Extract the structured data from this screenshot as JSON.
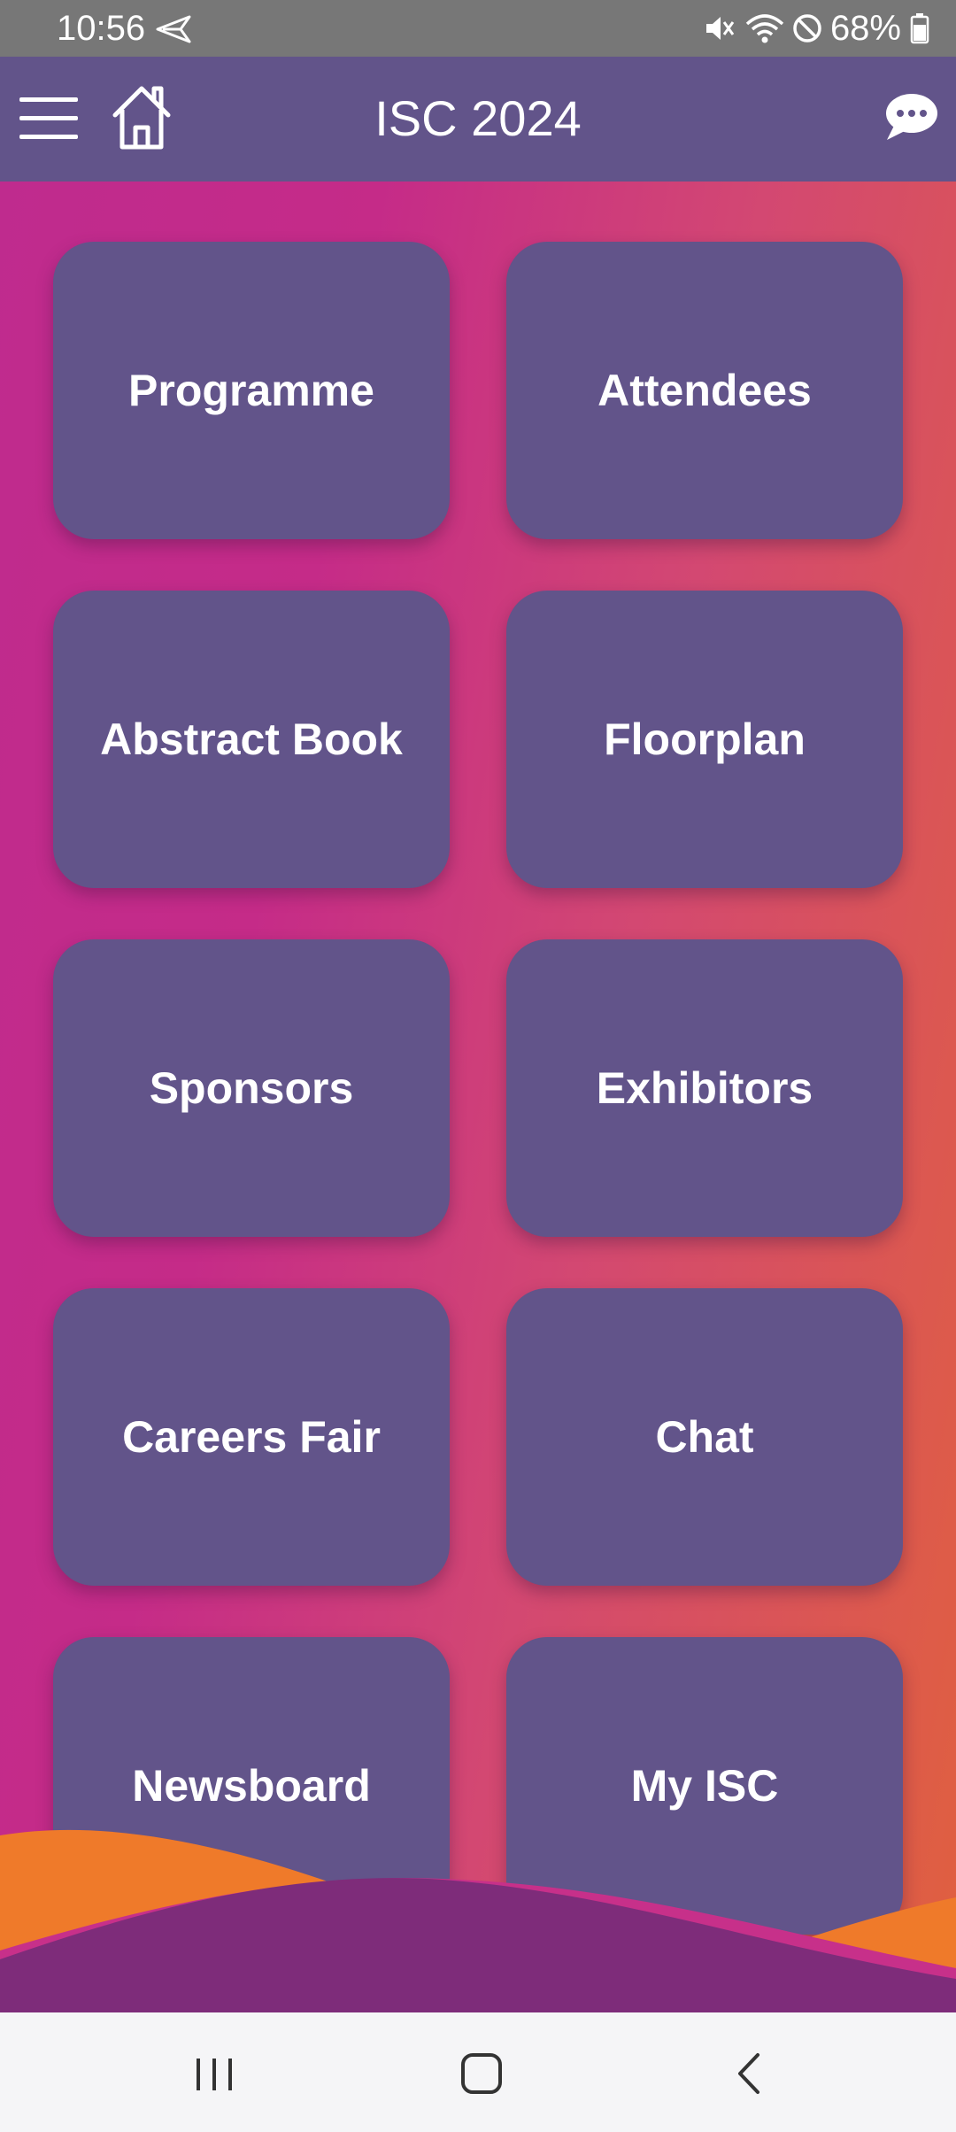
{
  "status_bar": {
    "time": "10:56",
    "battery": "68%",
    "icons": [
      "send-icon",
      "mute-icon",
      "wifi-icon",
      "do-not-disturb-icon",
      "battery-icon"
    ]
  },
  "app_bar": {
    "title": "ISC 2024",
    "menu_icon": "hamburger-menu-icon",
    "home_icon": "home-icon",
    "chat_icon": "chat-bubble-icon"
  },
  "tiles": [
    {
      "label": "Programme"
    },
    {
      "label": "Attendees"
    },
    {
      "label": "Abstract Book"
    },
    {
      "label": "Floorplan"
    },
    {
      "label": "Sponsors"
    },
    {
      "label": "Exhibitors"
    },
    {
      "label": "Careers Fair"
    },
    {
      "label": "Chat"
    },
    {
      "label": "Newsboard"
    },
    {
      "label": "My ISC"
    }
  ],
  "colors": {
    "primary": "#62548a",
    "gradient_start": "#bf2b8e",
    "gradient_end": "#e0603f",
    "wave_orange": "#ef7a2a",
    "wave_purple": "#7e2c7a"
  },
  "nav_bar": {
    "icons": [
      "recents-icon",
      "home-circle-icon",
      "back-icon"
    ]
  }
}
